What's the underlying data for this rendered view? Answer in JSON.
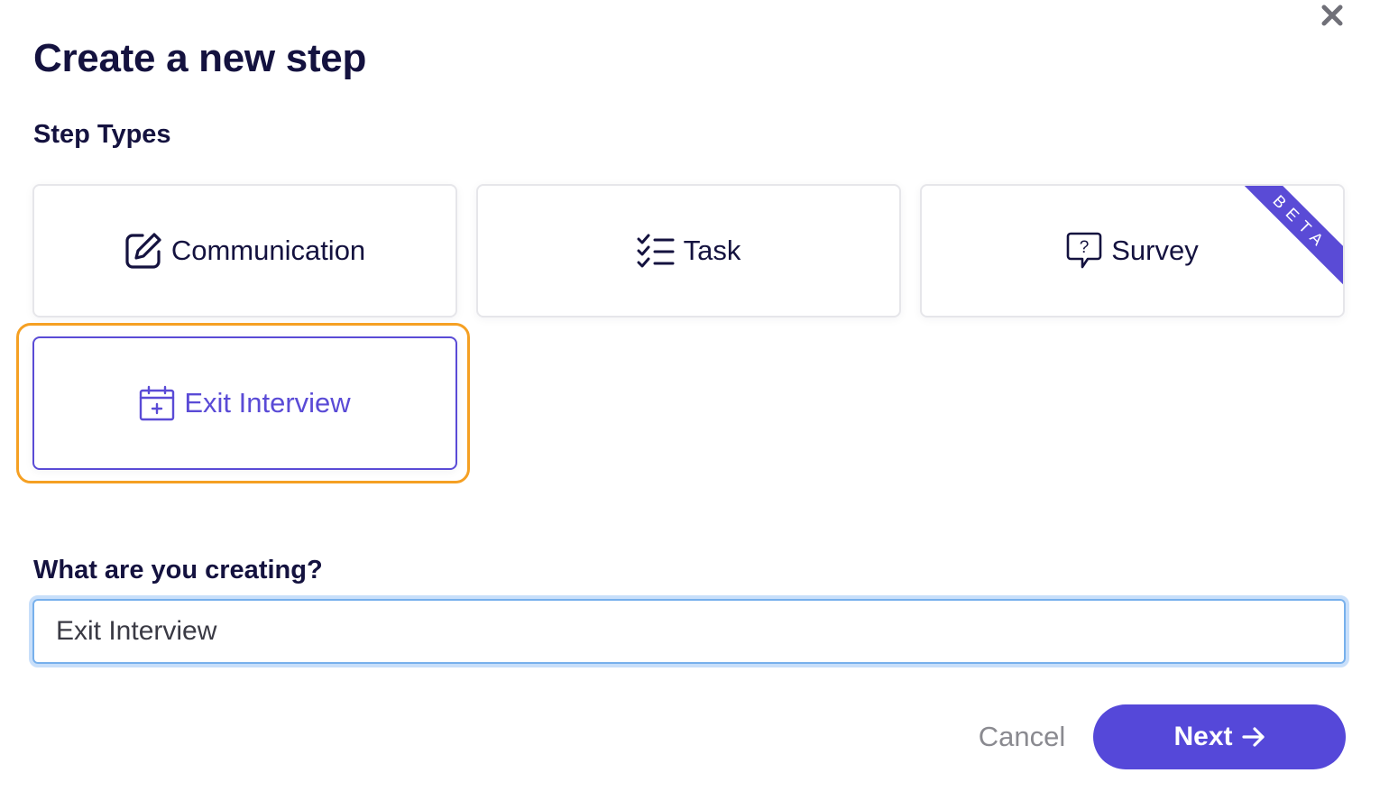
{
  "dialog": {
    "title": "Create a new step",
    "close_icon": "close-icon"
  },
  "step_types": {
    "label": "Step Types",
    "items": [
      {
        "label": "Communication",
        "icon": "edit-square-icon"
      },
      {
        "label": "Task",
        "icon": "checklist-icon"
      },
      {
        "label": "Survey",
        "icon": "question-bubble-icon",
        "badge": "BETA"
      },
      {
        "label": "Exit Interview",
        "icon": "calendar-add-icon",
        "selected": true
      }
    ]
  },
  "creating": {
    "label": "What are you creating?",
    "value": "Exit Interview"
  },
  "footer": {
    "cancel_label": "Cancel",
    "next_label": "Next",
    "next_icon": "arrow-right-icon"
  },
  "colors": {
    "accent": "#5548d9",
    "focus": "#f5a023",
    "heading": "#14123f"
  }
}
